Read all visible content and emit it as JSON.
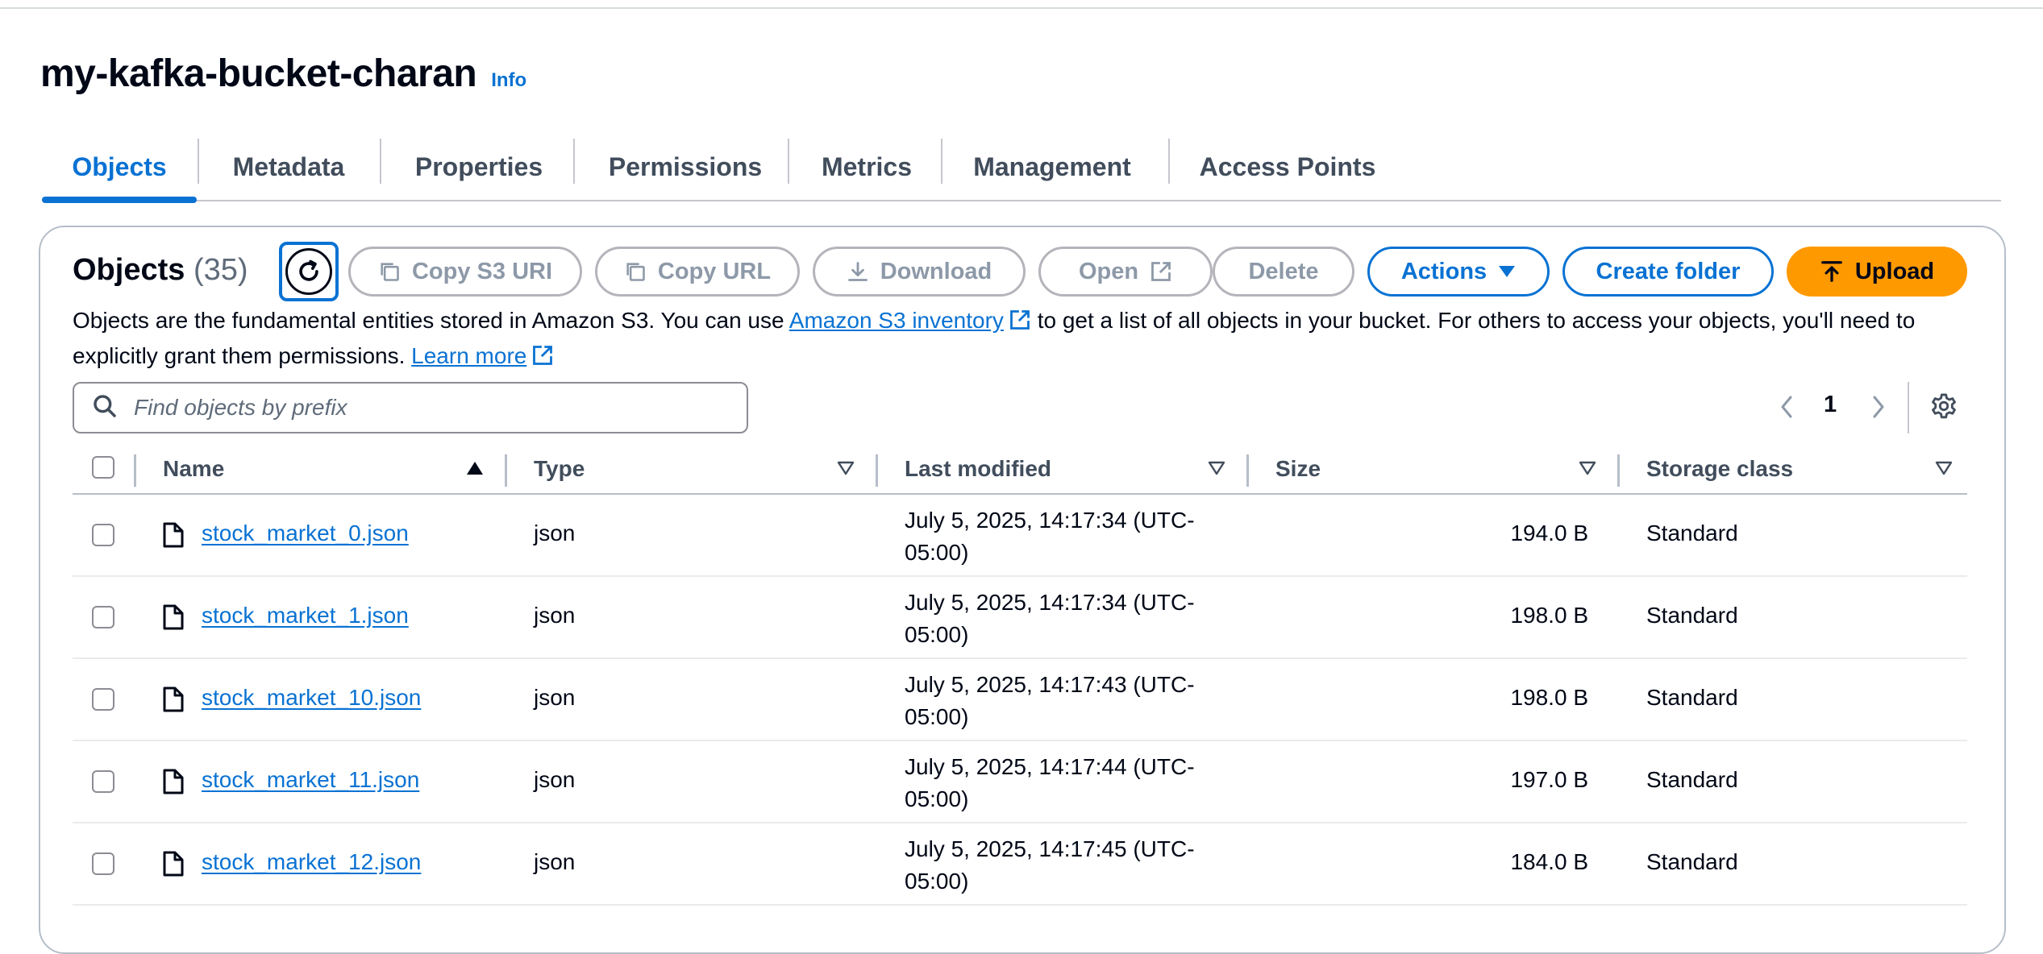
{
  "bucket": {
    "title": "my-kafka-bucket-charan",
    "info_label": "Info"
  },
  "tabs": [
    {
      "label": "Objects",
      "active": true
    },
    {
      "label": "Metadata"
    },
    {
      "label": "Properties"
    },
    {
      "label": "Permissions"
    },
    {
      "label": "Metrics"
    },
    {
      "label": "Management"
    },
    {
      "label": "Access Points"
    }
  ],
  "objects_panel": {
    "title": "Objects",
    "count": "(35)",
    "buttons": {
      "copy_s3_uri": "Copy S3 URI",
      "copy_url": "Copy URL",
      "download": "Download",
      "open": "Open",
      "delete": "Delete",
      "actions": "Actions",
      "create_folder": "Create folder",
      "upload": "Upload"
    },
    "description": {
      "part1": "Objects are the fundamental entities stored in Amazon S3. You can use ",
      "inventory_link": "Amazon S3 inventory",
      "part2": " to get a list of all objects in your bucket. For others to access your objects, you'll need to explicitly grant them permissions. ",
      "learn_more": "Learn more"
    },
    "search": {
      "placeholder": "Find objects by prefix"
    },
    "pagination": {
      "current_page": "1"
    }
  },
  "table": {
    "headers": {
      "name": "Name",
      "type": "Type",
      "last_modified": "Last modified",
      "size": "Size",
      "storage_class": "Storage class"
    },
    "rows": [
      {
        "name": "stock_market_0.json",
        "type": "json",
        "date_line1": "July 5, 2025, 14:17:34 (UTC-",
        "date_line2": "05:00)",
        "size": "194.0 B",
        "storage_class": "Standard"
      },
      {
        "name": "stock_market_1.json",
        "type": "json",
        "date_line1": "July 5, 2025, 14:17:34 (UTC-",
        "date_line2": "05:00)",
        "size": "198.0 B",
        "storage_class": "Standard"
      },
      {
        "name": "stock_market_10.json",
        "type": "json",
        "date_line1": "July 5, 2025, 14:17:43 (UTC-",
        "date_line2": "05:00)",
        "size": "198.0 B",
        "storage_class": "Standard"
      },
      {
        "name": "stock_market_11.json",
        "type": "json",
        "date_line1": "July 5, 2025, 14:17:44 (UTC-",
        "date_line2": "05:00)",
        "size": "197.0 B",
        "storage_class": "Standard"
      },
      {
        "name": "stock_market_12.json",
        "type": "json",
        "date_line1": "July 5, 2025, 14:17:45 (UTC-",
        "date_line2": "05:00)",
        "size": "184.0 B",
        "storage_class": "Standard"
      }
    ]
  },
  "colors": {
    "link_blue": "#0972d3",
    "upload_orange": "#ff9900",
    "disabled_gray": "#8d99a8",
    "border": "#b6bec9"
  },
  "icons": [
    "refresh-icon",
    "copy-icon",
    "download-icon",
    "external-link-icon",
    "caret-down-icon",
    "upload-icon",
    "search-icon",
    "chevron-left-icon",
    "chevron-right-icon",
    "gear-icon",
    "sort-asc-icon",
    "sort-desc-icon",
    "file-icon"
  ]
}
